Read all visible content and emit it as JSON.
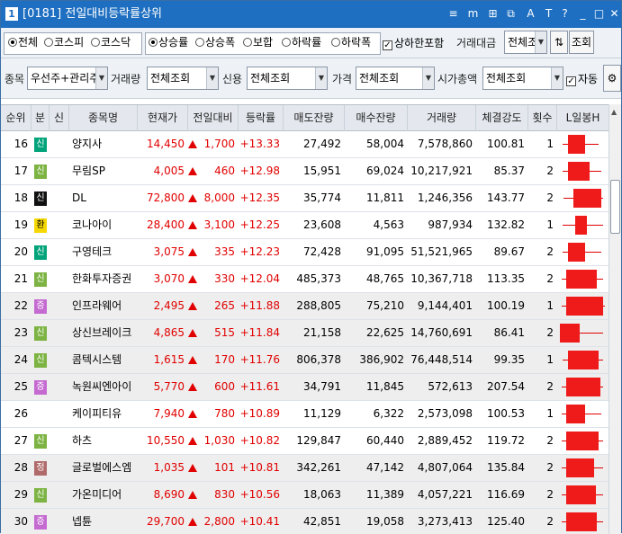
{
  "window": {
    "number": "1",
    "title": "[0181] 전일대비등락률상위",
    "controls": [
      "≡",
      "m",
      "⊞",
      "⧉",
      "A",
      "T",
      "?",
      "_",
      "□",
      "✕"
    ]
  },
  "filters": {
    "market": {
      "options": [
        "전체",
        "코스피",
        "코스닥"
      ],
      "selected": "전체"
    },
    "sort": {
      "options": [
        "상승률",
        "상승폭",
        "보합",
        "하락률",
        "하락폭"
      ],
      "selected": "상승률"
    },
    "include_limit": {
      "label": "상하한포함",
      "checked": true
    },
    "trade_amount": {
      "label": "거래대금",
      "value": "전체조"
    },
    "query_button": "조회",
    "item": {
      "label": "종목",
      "value": "우선주+관리주"
    },
    "volume": {
      "label": "거래량",
      "value": "전체조회"
    },
    "credit": {
      "label": "신용",
      "value": "전체조회"
    },
    "price": {
      "label": "가격",
      "value": "전체조회"
    },
    "market_cap": {
      "label": "시가총액",
      "value": "전체조회"
    },
    "auto": {
      "label": "자동",
      "checked": true
    }
  },
  "table": {
    "headers": [
      "순위",
      "분",
      "신",
      "종목명",
      "현재가",
      "전일대비",
      "등락률",
      "매도잔량",
      "매수잔량",
      "거래량",
      "체결강도",
      "횟수",
      "L일봉H"
    ],
    "rows": [
      {
        "rank": "16",
        "market": "신",
        "market_color": "#00a37a",
        "name": "양지사",
        "price": "14,450",
        "change": "1,700",
        "rate": "+13.33",
        "ask": "27,492",
        "bid": "58,004",
        "volume": "7,578,860",
        "strength": "100.81",
        "count": "1",
        "candle": [
          0.2,
          0.55,
          0.08,
          0.85
        ]
      },
      {
        "rank": "17",
        "market": "신",
        "market_color": "#7cb342",
        "name": "무림SP",
        "price": "4,005",
        "change": "460",
        "rate": "+12.98",
        "ask": "15,951",
        "bid": "69,024",
        "volume": "10,217,921",
        "strength": "85.37",
        "count": "2",
        "candle": [
          0.2,
          0.65,
          0.08,
          0.9
        ]
      },
      {
        "rank": "18",
        "market": "신",
        "market_color": "#111111",
        "name": "DL",
        "price": "72,800",
        "change": "8,000",
        "rate": "+12.35",
        "ask": "35,774",
        "bid": "11,811",
        "volume": "1,246,356",
        "strength": "143.77",
        "count": "2",
        "candle": [
          0.3,
          0.9,
          0.1,
          0.95
        ]
      },
      {
        "rank": "19",
        "market": "환",
        "market_color": "#f5d800",
        "name": "코나아이",
        "price": "28,400",
        "change": "3,100",
        "rate": "+12.25",
        "ask": "23,608",
        "bid": "4,563",
        "volume": "987,934",
        "strength": "132.82",
        "count": "1",
        "candle": [
          0.35,
          0.6,
          0.08,
          0.95
        ]
      },
      {
        "rank": "20",
        "market": "신",
        "market_color": "#00a37a",
        "name": "구영테크",
        "price": "3,075",
        "change": "335",
        "rate": "+12.23",
        "ask": "72,428",
        "bid": "91,095",
        "volume": "51,521,965",
        "strength": "89.67",
        "count": "2",
        "candle": [
          0.2,
          0.55,
          0.08,
          0.9
        ]
      },
      {
        "rank": "21",
        "market": "신",
        "market_color": "#7cb342",
        "name": "한화투자증권",
        "price": "3,070",
        "change": "330",
        "rate": "+12.04",
        "ask": "485,373",
        "bid": "48,765",
        "volume": "10,367,718",
        "strength": "113.35",
        "count": "2",
        "candle": [
          0.15,
          0.8,
          0.05,
          0.95
        ]
      },
      {
        "rank": "22",
        "market": "증",
        "market_color": "#c46ad0",
        "name": "인프라웨어",
        "price": "2,495",
        "change": "265",
        "rate": "+11.88",
        "ask": "288,805",
        "bid": "75,210",
        "volume": "9,144,401",
        "strength": "100.19",
        "count": "1",
        "candle": [
          0.15,
          0.95,
          0.05,
          0.98
        ]
      },
      {
        "rank": "23",
        "market": "신",
        "market_color": "#7cb342",
        "name": "상신브레이크",
        "price": "4,865",
        "change": "515",
        "rate": "+11.84",
        "ask": "21,158",
        "bid": "22,625",
        "volume": "14,760,691",
        "strength": "86.41",
        "count": "2",
        "candle": [
          0.02,
          0.45,
          0.02,
          0.95
        ]
      },
      {
        "rank": "24",
        "market": "신",
        "market_color": "#7cb342",
        "name": "콤텍시스템",
        "price": "1,615",
        "change": "170",
        "rate": "+11.76",
        "ask": "806,378",
        "bid": "386,902",
        "volume": "76,448,514",
        "strength": "99.35",
        "count": "1",
        "candle": [
          0.2,
          0.85,
          0.08,
          0.95
        ]
      },
      {
        "rank": "25",
        "market": "증",
        "market_color": "#c46ad0",
        "name": "녹원씨엔아이",
        "price": "5,770",
        "change": "600",
        "rate": "+11.61",
        "ask": "34,791",
        "bid": "11,845",
        "volume": "572,613",
        "strength": "207.54",
        "count": "2",
        "candle": [
          0.15,
          0.88,
          0.05,
          0.95
        ]
      },
      {
        "rank": "26",
        "market": "",
        "market_color": "",
        "name": "케이피티유",
        "price": "7,940",
        "change": "780",
        "rate": "+10.89",
        "ask": "11,129",
        "bid": "6,322",
        "volume": "2,573,098",
        "strength": "100.53",
        "count": "1",
        "candle": [
          0.15,
          0.55,
          0.05,
          0.9
        ]
      },
      {
        "rank": "27",
        "market": "신",
        "market_color": "#7cb342",
        "name": "하츠",
        "price": "10,550",
        "change": "1,030",
        "rate": "+10.82",
        "ask": "129,847",
        "bid": "60,440",
        "volume": "2,889,452",
        "strength": "119.72",
        "count": "2",
        "candle": [
          0.15,
          0.85,
          0.05,
          0.95
        ]
      },
      {
        "rank": "28",
        "market": "정",
        "market_color": "#b06a6a",
        "name": "글로벌에스엠",
        "price": "1,035",
        "change": "101",
        "rate": "+10.81",
        "ask": "342,261",
        "bid": "47,142",
        "volume": "4,807,064",
        "strength": "135.84",
        "count": "2",
        "candle": [
          0.15,
          0.75,
          0.05,
          0.95
        ]
      },
      {
        "rank": "29",
        "market": "신",
        "market_color": "#7cb342",
        "name": "가온미디어",
        "price": "8,690",
        "change": "830",
        "rate": "+10.56",
        "ask": "18,063",
        "bid": "11,389",
        "volume": "4,057,221",
        "strength": "116.69",
        "count": "2",
        "candle": [
          0.15,
          0.78,
          0.05,
          0.95
        ]
      },
      {
        "rank": "30",
        "market": "증",
        "market_color": "#c46ad0",
        "name": "넵튠",
        "price": "29,700",
        "change": "2,800",
        "rate": "+10.41",
        "ask": "42,851",
        "bid": "19,058",
        "volume": "3,273,413",
        "strength": "125.40",
        "count": "2",
        "candle": [
          0.15,
          0.8,
          0.05,
          0.95
        ]
      }
    ]
  },
  "colors": {
    "up": "#e10000",
    "title_bar": "#1e6fc1"
  }
}
